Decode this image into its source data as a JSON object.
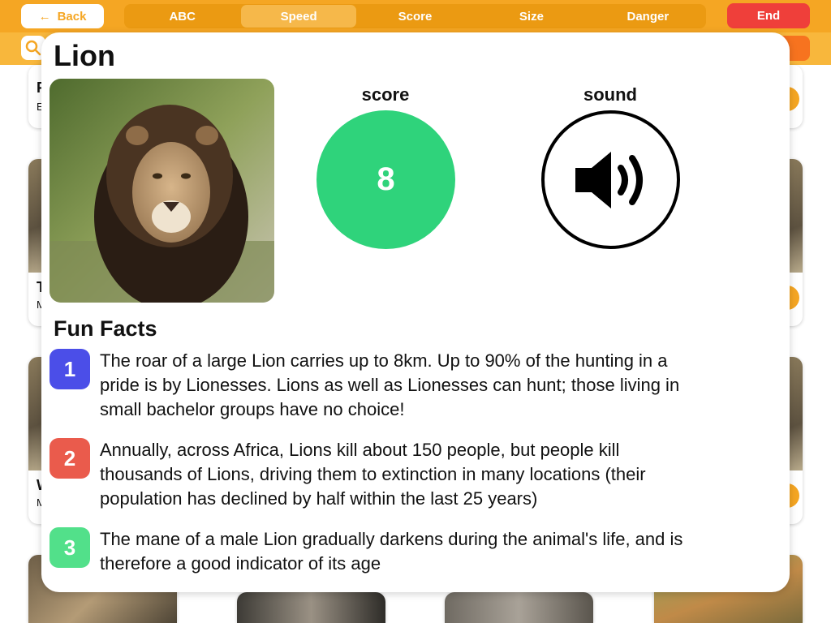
{
  "toolbar": {
    "back_label": "Back",
    "tabs": [
      {
        "label": "ABC",
        "active": false
      },
      {
        "label": "Speed",
        "active": true
      },
      {
        "label": "Score",
        "active": false
      },
      {
        "label": "Size",
        "active": false
      },
      {
        "label": "Danger",
        "active": false
      }
    ],
    "end_label": "End"
  },
  "background_cards": {
    "card1_letter": "F",
    "card1_sub": "E",
    "card2_letter": "T",
    "card2_sub": "M",
    "card3_letter": "W",
    "card3_sub": "M"
  },
  "animal": {
    "name": "Lion",
    "score_label": "score",
    "score": "8",
    "sound_label": "sound",
    "score_color": "#2fd37b"
  },
  "fun_facts": {
    "heading": "Fun Facts",
    "items": [
      {
        "number": "1",
        "color": "#4b4ee8",
        "text": "The roar of a large Lion carries up to 8km. Up to 90% of the hunting in a pride is by Lionesses. Lions as well as Lionesses can hunt; those living in small bachelor groups have no choice!"
      },
      {
        "number": "2",
        "color": "#ea5b4c",
        "text": "Annually, across Africa, Lions kill about 150 people, but people kill thousands of Lions, driving them to extinction in many locations (their population has declined by half within the last 25 years)"
      },
      {
        "number": "3",
        "color": "#52e08a",
        "text": "The mane of a male Lion gradually darkens during the animal's life, and is therefore a good indicator of its age"
      }
    ]
  },
  "colors": {
    "toolbar": "#f5a623",
    "end_button": "#ef3f3a"
  }
}
